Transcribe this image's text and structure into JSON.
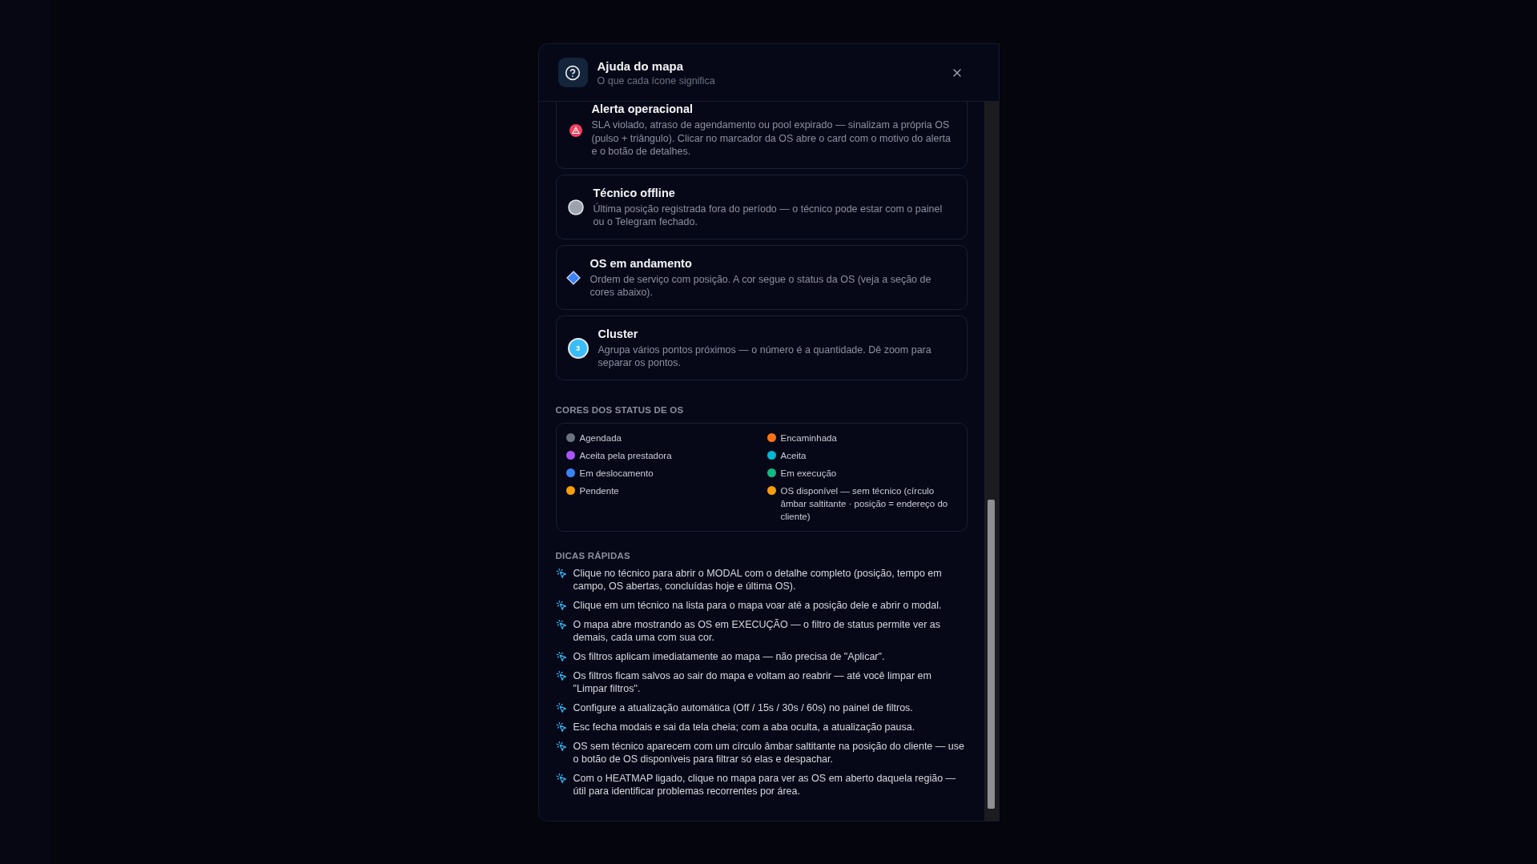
{
  "modal": {
    "title": "Ajuda do mapa",
    "subtitle": "O que cada ícone significa",
    "legend": [
      {
        "kind": "alert",
        "title": "Alerta operacional",
        "description": "SLA violado, atraso de agendamento ou pool expirado — sinalizam a própria OS (pulso + triângulo). Clicar no marcador da OS abre o card com o motivo do alerta e o botão de detalhes."
      },
      {
        "kind": "offline",
        "title": "Técnico offline",
        "description": "Última posição registrada fora do período — o técnico pode estar com o painel ou o Telegram fechado."
      },
      {
        "kind": "order",
        "title": "OS em andamento",
        "description": "Ordem de serviço com posição. A cor segue o status da OS (veja a seção de cores abaixo)."
      },
      {
        "kind": "cluster",
        "title": "Cluster",
        "count": "3",
        "description": "Agrupa vários pontos próximos — o número é a quantidade. Dê zoom para separar os pontos."
      }
    ],
    "status_heading": "CORES DOS STATUS DE OS",
    "statuses": [
      {
        "label": "Agendada",
        "color": "#6b7280"
      },
      {
        "label": "Encaminhada",
        "color": "#f97316"
      },
      {
        "label": "Aceita pela prestadora",
        "color": "#a855f7"
      },
      {
        "label": "Aceita",
        "color": "#06b6d4"
      },
      {
        "label": "Em deslocamento",
        "color": "#3b82f6"
      },
      {
        "label": "Em execução",
        "color": "#10b981"
      },
      {
        "label": "Pendente",
        "color": "#f59e0b"
      },
      {
        "label": "OS disponível — sem técnico (círculo âmbar saltitante · posição = endereço do cliente)",
        "color": "#f59e0b"
      }
    ],
    "tips_heading": "DICAS RÁPIDAS",
    "tips": [
      "Clique no técnico para abrir o MODAL com o detalhe completo (posição, tempo em campo, OS abertas, concluídas hoje e última OS).",
      "Clique em um técnico na lista para o mapa voar até a posição dele e abrir o modal.",
      "O mapa abre mostrando as OS em EXECUÇÃO — o filtro de status permite ver as demais, cada uma com sua cor.",
      "Os filtros aplicam imediatamente ao mapa — não precisa de \"Aplicar\".",
      "Os filtros ficam salvos ao sair do mapa e voltam ao reabrir — até você limpar em \"Limpar filtros\".",
      "Configure a atualização automática (Off / 15s / 30s / 60s) no painel de filtros.",
      "Esc fecha modais e sai da tela cheia; com a aba oculta, a atualização pausa.",
      "OS sem técnico aparecem com um círculo âmbar saltitante na posição do cliente — use o botão de OS disponíveis para filtrar só elas e despachar.",
      "Com o HEATMAP ligado, clique no mapa para ver as OS em aberto daquela região — útil para identificar problemas recorrentes por área."
    ]
  }
}
